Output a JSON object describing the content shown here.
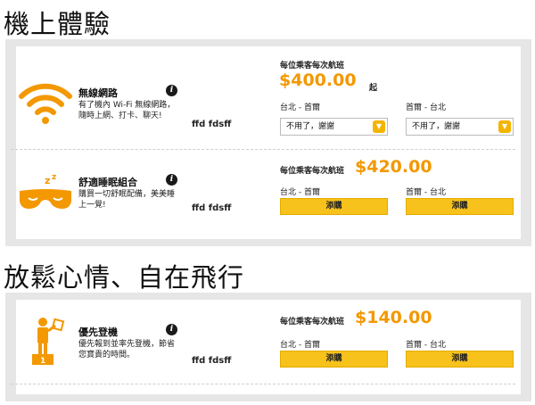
{
  "sections": [
    {
      "title": "機上體驗",
      "items": [
        {
          "icon": "wifi-icon",
          "name": "無線網路",
          "desc": "有了機內 Wi-Fi 無線網路，隨時上網、打卡、聊天!",
          "extra": "ffd  fdsff",
          "per_label": "每位乘客每次航班",
          "price": "$400.00",
          "qi": "起",
          "legs": [
            {
              "route": "台北  -  首爾",
              "select": "不用了，謝謝"
            },
            {
              "route": "首爾  -  台北",
              "select": "不用了，謝謝"
            }
          ]
        },
        {
          "icon": "sleep-mask-icon",
          "name": "舒適睡眠組合",
          "desc": "購買一切舒眠配備，美美睡上一覺!",
          "extra": "ffd  fdsff",
          "per_label": "每位乘客每次航班",
          "price": "$420.00",
          "legs": [
            {
              "route": "台北  -  首爾",
              "button": "添購"
            },
            {
              "route": "首爾  -  台北",
              "button": "添購"
            }
          ]
        }
      ]
    },
    {
      "title": "放鬆心情、自在飛行",
      "items": [
        {
          "icon": "priority-boarding-icon",
          "name": "優先登機",
          "desc": "優先報到並率先登機，節省您寶貴的時間。",
          "extra": "ffd  fdsff",
          "per_label": "每位乘客每次航班",
          "price": "$140.00",
          "legs": [
            {
              "route": "台北  -  首爾",
              "button": "添購"
            },
            {
              "route": "首爾  -  台北",
              "button": "添購"
            }
          ]
        }
      ]
    }
  ],
  "colors": {
    "accent": "#f39800",
    "button": "#f7c21b",
    "panel": "#e6e6e6"
  }
}
